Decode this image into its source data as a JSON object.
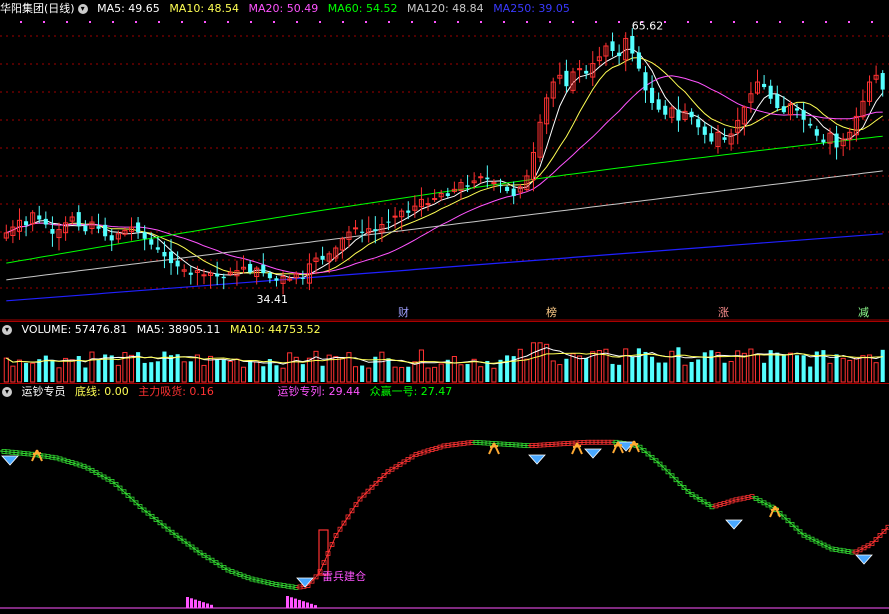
{
  "colors": {
    "up": "#ff3232",
    "down": "#54ffff",
    "ma5": "#ffffff",
    "ma10": "#ffff54",
    "ma20": "#ff54ff",
    "ma60": "#00ff00",
    "ma120": "#c8c8c8",
    "ma250": "#2020ff",
    "grid": "#a00000",
    "dot": "#ff54ff"
  },
  "price_header": {
    "title": "华阳集团(日线)",
    "ma5": "MA5: 49.65",
    "ma10": "MA10: 48.54",
    "ma20": "MA20: 50.49",
    "ma60": "MA60: 54.52",
    "ma120": "MA120: 48.84",
    "ma250": "MA250: 39.05"
  },
  "volume_header": {
    "vol": "VOLUME: 57476.81",
    "ma5": "MA5: 38905.11",
    "ma10": "MA10: 44753.52"
  },
  "indicator_header": {
    "name": "运钞专员",
    "base": "底线: 0.00",
    "main": "主力吸货: 0.16",
    "line1": "运钞专列: 29.44",
    "line2": "众赢一号: 27.47"
  },
  "annotations": {
    "high": "65.62",
    "low": "34.41",
    "signal": "雷兵建仓"
  },
  "tags": [
    {
      "text": "财",
      "color": "#a0a0ff"
    },
    {
      "text": "榜",
      "color": "#ffcc88"
    },
    {
      "text": "涨",
      "color": "#ff9090"
    },
    {
      "text": "减",
      "color": "#90ff90"
    }
  ],
  "chart_data": [
    {
      "type": "candlestick",
      "price_range": [
        33,
        67
      ],
      "high_label_value": 65.62,
      "low_label_value": 34.41,
      "closes": [
        41.6,
        42.3,
        43.1,
        42.5,
        44.0,
        43.2,
        42.6,
        41.5,
        42.0,
        42.8,
        43.5,
        42.4,
        41.8,
        42.9,
        42.1,
        41.2,
        40.7,
        41.5,
        41.9,
        42.3,
        41.7,
        40.9,
        40.2,
        39.6,
        38.8,
        38.0,
        37.6,
        37.2,
        36.6,
        37.1,
        36.6,
        36.8,
        36.4,
        36.2,
        36.9,
        37.1,
        37.5,
        36.9,
        37.4,
        36.8,
        36.2,
        35.9,
        36.4,
        36.1,
        36.7,
        36.2,
        37.9,
        38.6,
        38.4,
        39.1,
        39.8,
        40.9,
        41.7,
        42.2,
        41.6,
        42.1,
        41.8,
        42.6,
        42.9,
        43.6,
        44.2,
        44.0,
        44.8,
        45.6,
        45.1,
        45.7,
        46.3,
        46.0,
        46.8,
        47.6,
        47.1,
        47.8,
        48.3,
        48.0,
        47.6,
        47.3,
        46.6,
        46.0,
        47.1,
        48.4,
        51.2,
        54.8,
        57.7,
        59.6,
        60.4,
        59.1,
        60.8,
        61.2,
        60.6,
        61.8,
        62.6,
        63.9,
        63.3,
        62.7,
        64.8,
        63.0,
        61.2,
        58.6,
        57.1,
        56.3,
        55.7,
        56.5,
        55.0,
        56.1,
        55.4,
        54.2,
        53.3,
        52.5,
        53.6,
        52.7,
        53.4,
        55.0,
        56.6,
        58.2,
        59.6,
        59.0,
        57.6,
        56.5,
        56.0,
        57.0,
        56.2,
        55.1,
        54.4,
        53.2,
        52.4,
        53.5,
        51.8,
        52.8,
        53.6,
        55.5,
        57.3,
        59.6,
        60.4,
        58.7
      ],
      "volume_range": [
        0,
        75000
      ],
      "volume_last": 57476.81,
      "series": [
        {
          "name": "MA5",
          "last": 49.65
        },
        {
          "name": "MA10",
          "last": 48.54
        },
        {
          "name": "MA20",
          "last": 50.49
        },
        {
          "name": "MA60",
          "last": 54.52
        },
        {
          "name": "MA120",
          "last": 48.84
        },
        {
          "name": "MA250",
          "last": 39.05
        }
      ]
    },
    {
      "type": "line",
      "y_range": [
        0,
        100
      ],
      "series": [
        {
          "name": "运钞专列",
          "last": 29.44
        },
        {
          "name": "众赢一号",
          "last": 27.47
        }
      ],
      "keypoints": [
        [
          0,
          88
        ],
        [
          12,
          86
        ],
        [
          20,
          84
        ],
        [
          30,
          79
        ],
        [
          40,
          70
        ],
        [
          50,
          55
        ],
        [
          60,
          42
        ],
        [
          70,
          30
        ],
        [
          80,
          20
        ],
        [
          88,
          15
        ],
        [
          96,
          12
        ],
        [
          104,
          10
        ],
        [
          108,
          11
        ],
        [
          112,
          18
        ],
        [
          118,
          40
        ],
        [
          126,
          60
        ],
        [
          136,
          76
        ],
        [
          146,
          86
        ],
        [
          156,
          91
        ],
        [
          166,
          93
        ],
        [
          176,
          92
        ],
        [
          186,
          91
        ],
        [
          196,
          92
        ],
        [
          206,
          93
        ],
        [
          216,
          93
        ],
        [
          224,
          91
        ],
        [
          232,
          80
        ],
        [
          242,
          64
        ],
        [
          250,
          56
        ],
        [
          258,
          60
        ],
        [
          264,
          62
        ],
        [
          272,
          55
        ],
        [
          282,
          40
        ],
        [
          292,
          32
        ],
        [
          300,
          30
        ],
        [
          306,
          35
        ],
        [
          312,
          45
        ]
      ]
    }
  ]
}
